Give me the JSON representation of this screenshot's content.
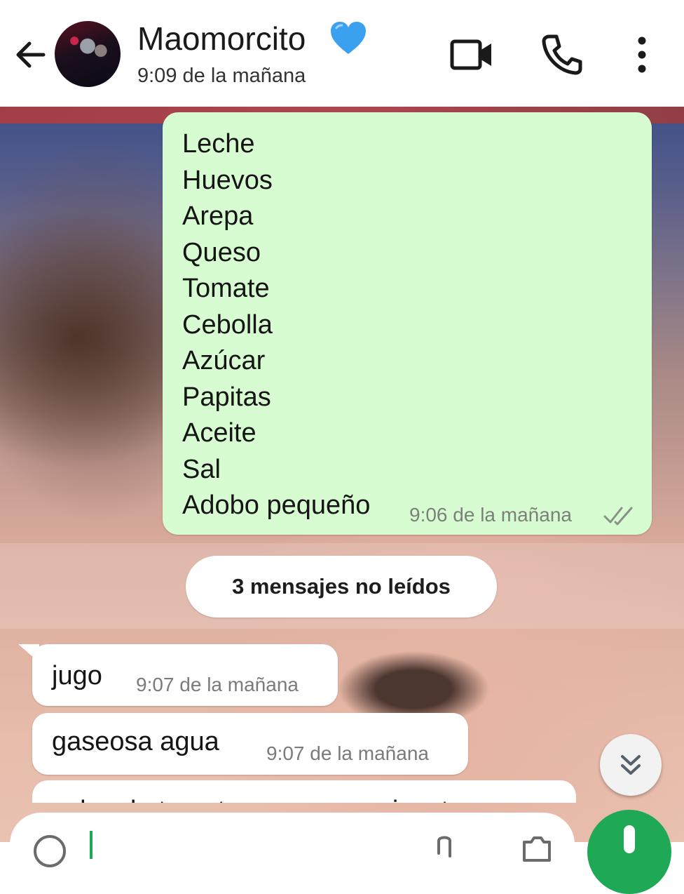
{
  "header": {
    "contact_name": "Maomorcito",
    "name_emoji": "💙",
    "last_seen": "9:09 de la mañana",
    "icons": {
      "back": "back-arrow-icon",
      "video": "video-call-icon",
      "call": "phone-icon",
      "menu": "more-vert-icon"
    }
  },
  "messages": {
    "outgoing_list": {
      "items": [
        "Leche",
        "Huevos",
        "Arepa",
        "Queso",
        "Tomate",
        "Cebolla",
        "Azúcar",
        "Papitas",
        "Aceite",
        "Sal",
        "Adobo pequeño"
      ],
      "time": "9:06 de la mañana",
      "status_icon": "double-check-icon"
    },
    "unread_divider": "3 mensajes no leídos",
    "incoming": [
      {
        "text": "jugo",
        "time": "9:07 de la mañana"
      },
      {
        "text": "gaseosa agua",
        "time": "9:07 de la mañana"
      },
      {
        "text": "salsa de tomate mayonesa picante",
        "time": ""
      }
    ]
  },
  "composer": {
    "placeholder": "",
    "icons": {
      "emoji": "emoji-icon",
      "attach": "attach-icon",
      "camera": "camera-icon",
      "mic": "mic-icon"
    }
  },
  "colors": {
    "outgoing_bubble": "#d8fcd1",
    "incoming_bubble": "#ffffff",
    "accent_green": "#1fa855",
    "heart_blue": "#3aa0f0"
  }
}
